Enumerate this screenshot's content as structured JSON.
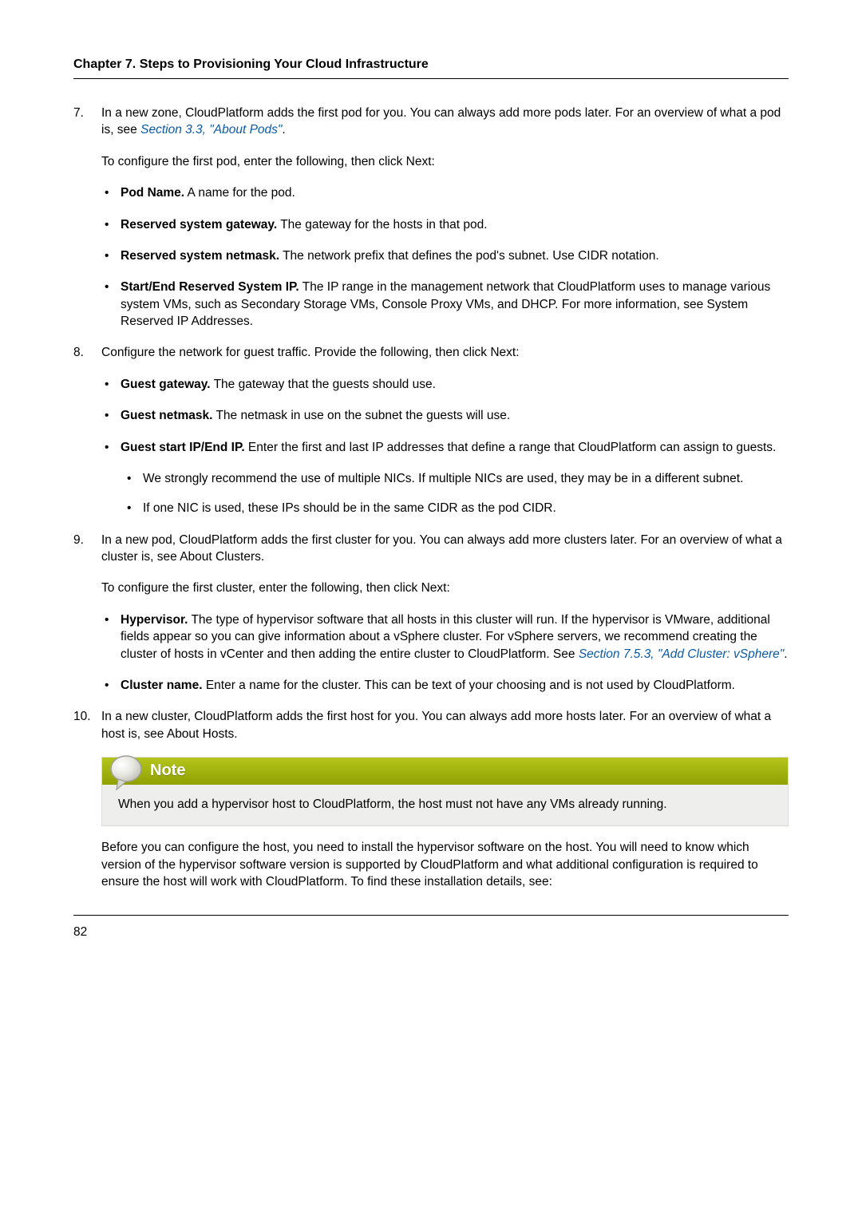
{
  "chapter_heading": "Chapter 7. Steps to Provisioning Your Cloud Infrastructure",
  "page_number": "82",
  "items": {
    "7": {
      "num": "7.",
      "p1_a": "In a new zone, CloudPlatform adds the first pod for you. You can always add more pods later. For an overview of what a pod is, see ",
      "p1_link": "Section 3.3, \"About Pods\"",
      "p1_b": ".",
      "p2": "To configure the first pod, enter the following, then click Next:",
      "b1_label": "Pod Name.",
      "b1_text": " A name for the pod.",
      "b2_label": "Reserved system gateway.",
      "b2_text": " The gateway for the hosts in that pod.",
      "b3_label": "Reserved system netmask.",
      "b3_text": " The network prefix that defines the pod's subnet. Use CIDR notation.",
      "b4_label": "Start/End Reserved System IP.",
      "b4_text": " The IP range in the management network that CloudPlatform uses to manage various system VMs, such as Secondary Storage VMs, Console Proxy VMs, and DHCP. For more information, see System Reserved IP Addresses."
    },
    "8": {
      "num": "8.",
      "p1": "Configure the network for guest traffic. Provide the following, then click Next:",
      "b1_label": "Guest gateway.",
      "b1_text": " The gateway that the guests should use.",
      "b2_label": "Guest netmask.",
      "b2_text": " The netmask in use on the subnet the guests will use.",
      "b3_label": "Guest start IP/End IP.",
      "b3_text": " Enter the first and last IP addresses that define a range that CloudPlatform can assign to guests.",
      "sb1": "We strongly recommend the use of multiple NICs. If multiple NICs are used, they may be in a different subnet.",
      "sb2": "If one NIC is used, these IPs should be in the same CIDR as the pod CIDR."
    },
    "9": {
      "num": "9.",
      "p1": "In a new pod, CloudPlatform adds the first cluster for you. You can always add more clusters later. For an overview of what a cluster is, see About Clusters.",
      "p2": "To configure the first cluster, enter the following, then click Next:",
      "b1_label": "Hypervisor.",
      "b1_text_a": " The type of hypervisor software that all hosts in this cluster will run. If the hypervisor is VMware, additional fields appear so you can give information about a vSphere cluster. For vSphere servers, we recommend creating the cluster of hosts in vCenter and then adding the entire cluster to CloudPlatform. See ",
      "b1_link": "Section 7.5.3, \"Add Cluster: vSphere\"",
      "b1_text_b": ".",
      "b2_label": "Cluster name.",
      "b2_text": " Enter a name for the cluster. This can be text of your choosing and is not used by CloudPlatform."
    },
    "10": {
      "num": "10.",
      "p1": "In a new cluster, CloudPlatform adds the first host for you. You can always add more hosts later. For an overview of what a host is, see About Hosts.",
      "note_title": "Note",
      "note_body": "When you add a hypervisor host to CloudPlatform, the host must not have any VMs already running.",
      "p2": "Before you can configure the host, you need to install the hypervisor software on the host. You will need to know which version of the hypervisor software version is supported by CloudPlatform and what additional configuration is required to ensure the host will work with CloudPlatform. To find these installation details, see:"
    }
  }
}
